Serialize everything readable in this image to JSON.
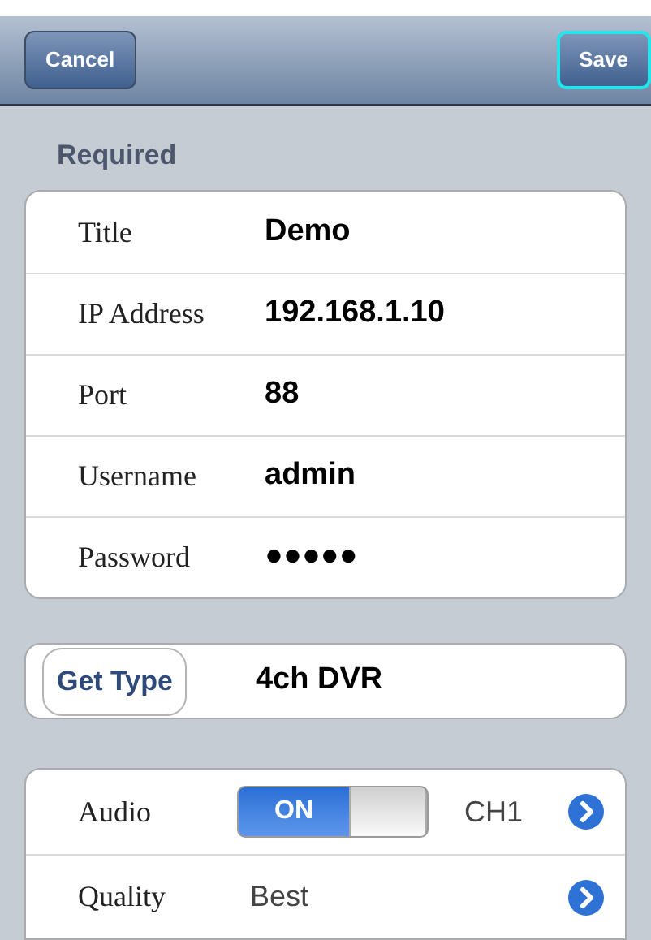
{
  "nav": {
    "buttons": [
      {
        "label": "Cancel",
        "focused": false
      },
      {
        "label": "Save",
        "focused": true
      }
    ]
  },
  "required": {
    "title": "Required",
    "fields": [
      {
        "label": "Title",
        "value": "Demo"
      },
      {
        "label": "IP Address",
        "value": "192.168.1.10"
      },
      {
        "label": "Port",
        "value": "88"
      },
      {
        "label": "Username",
        "value": "admin"
      },
      {
        "label": "Password",
        "value": "●●●●●"
      }
    ]
  },
  "device_type": {
    "button": "Get Type",
    "value": "4ch DVR"
  },
  "options": [
    {
      "kind": "toggle",
      "label": "Audio",
      "on": true,
      "toggle_label": "ON",
      "value": "CH1"
    },
    {
      "kind": "select",
      "label": "Quality",
      "value": "Best"
    }
  ]
}
